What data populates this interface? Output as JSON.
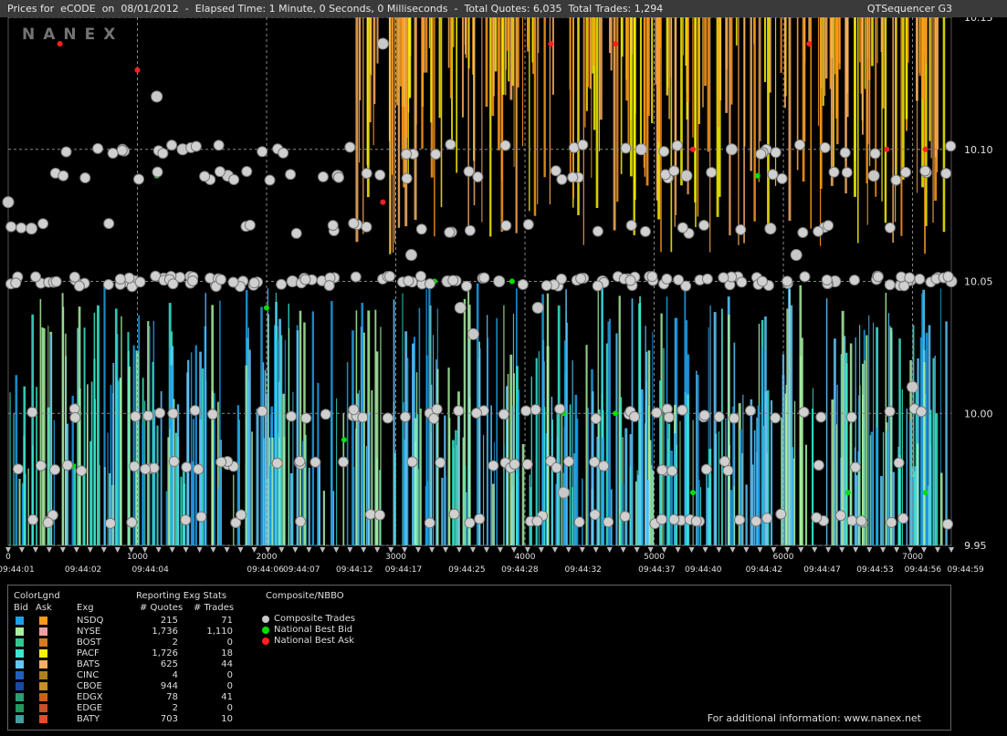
{
  "header": {
    "left_text": "Prices for  eCODE  on  08/01/2012  -  Elapsed Time: 1 Minute, 0 Seconds, 0 Milliseconds  -  Total Quotes: 6,035  Total Trades: 1,294",
    "right_text": "QTSequencer G3"
  },
  "watermark": "NANEX",
  "chart_data": {
    "type": "scatter",
    "title": "Prices for eCODE on 08/01/2012",
    "ylim": [
      9.95,
      10.15
    ],
    "y_ticks": [
      "10.15",
      "10.10",
      "10.05",
      "10.00",
      "9.95"
    ],
    "y_tick_values": [
      10.15,
      10.1,
      10.05,
      10.0,
      9.95
    ],
    "xlim": [
      0,
      7300
    ],
    "x_ticks": [
      "0",
      "1000",
      "2000",
      "3000",
      "4000",
      "5000",
      "6000",
      "7000"
    ],
    "x_tick_values": [
      0,
      1000,
      2000,
      3000,
      4000,
      5000,
      6000,
      7000
    ],
    "time_labels": [
      {
        "seq": 60,
        "label": "09:44:01"
      },
      {
        "seq": 580,
        "label": "09:44:02"
      },
      {
        "seq": 1100,
        "label": "09:44:04"
      },
      {
        "seq": 1990,
        "label": "09:44:06"
      },
      {
        "seq": 2270,
        "label": "09:44:07"
      },
      {
        "seq": 2680,
        "label": "09:44:12"
      },
      {
        "seq": 3060,
        "label": "09:44:17"
      },
      {
        "seq": 3550,
        "label": "09:44:25"
      },
      {
        "seq": 3960,
        "label": "09:44:28"
      },
      {
        "seq": 4450,
        "label": "09:44:32"
      },
      {
        "seq": 5020,
        "label": "09:44:37"
      },
      {
        "seq": 5380,
        "label": "09:44:40"
      },
      {
        "seq": 5850,
        "label": "09:44:42"
      },
      {
        "seq": 6300,
        "label": "09:44:47"
      },
      {
        "seq": 6710,
        "label": "09:44:53"
      },
      {
        "seq": 7080,
        "label": "09:44:56"
      },
      {
        "seq": 7410,
        "label": "09:44:59"
      }
    ],
    "grid": true,
    "series": [
      {
        "name": "Composite Trades",
        "color": "#c8c8c8",
        "points": [
          [
            0,
            10.08
          ],
          [
            180,
            10.07
          ],
          [
            900,
            10.05
          ],
          [
            1150,
            10.12
          ],
          [
            1350,
            10.1
          ],
          [
            1700,
            10.09
          ],
          [
            2200,
            10.05
          ],
          [
            2550,
            10.09
          ],
          [
            2900,
            10.14
          ],
          [
            3120,
            10.06
          ],
          [
            3400,
            10.05
          ],
          [
            3500,
            10.04
          ],
          [
            3600,
            10.03
          ],
          [
            3800,
            10.05
          ],
          [
            4100,
            10.04
          ],
          [
            4300,
            9.97
          ],
          [
            4600,
            10.05
          ],
          [
            4900,
            10.1
          ],
          [
            5250,
            10.09
          ],
          [
            5600,
            10.1
          ],
          [
            5900,
            10.07
          ],
          [
            6100,
            10.06
          ],
          [
            6400,
            10.05
          ],
          [
            6700,
            10.09
          ],
          [
            7000,
            10.01
          ],
          [
            7300,
            10.05
          ]
        ]
      },
      {
        "name": "National Best Bid",
        "color": "#00e000",
        "points": [
          [
            500,
            9.98
          ],
          [
            1150,
            10.09
          ],
          [
            2000,
            10.04
          ],
          [
            2600,
            9.99
          ],
          [
            3300,
            10.05
          ],
          [
            3900,
            10.05
          ],
          [
            4300,
            10.0
          ],
          [
            4700,
            10.0
          ],
          [
            5300,
            9.97
          ],
          [
            5800,
            10.09
          ],
          [
            6500,
            9.97
          ],
          [
            7100,
            9.97
          ]
        ]
      },
      {
        "name": "National Best Ask",
        "color": "#ff2020",
        "points": [
          [
            400,
            10.14
          ],
          [
            1000,
            10.13
          ],
          [
            2900,
            10.08
          ],
          [
            3200,
            10.07
          ],
          [
            4200,
            10.14
          ],
          [
            4700,
            10.14
          ],
          [
            5300,
            10.1
          ],
          [
            6200,
            10.14
          ],
          [
            6800,
            10.1
          ],
          [
            7100,
            10.1
          ]
        ]
      }
    ]
  },
  "legend": {
    "col_colorlgnd": "ColorLgnd",
    "col_bid": "Bid",
    "col_ask": "Ask",
    "col_exg": "Exg",
    "col_reporting": "Reporting Exg Stats",
    "col_quotes": "# Quotes",
    "col_trades": "# Trades",
    "col_composite": "Composite/NBBO",
    "rows": [
      {
        "exg": "NSDQ",
        "quotes": "215",
        "trades": "71",
        "bid_color": "#1ea0e8",
        "ask_color": "#ff9a1a"
      },
      {
        "exg": "NYSE",
        "quotes": "1,736",
        "trades": "1,110",
        "bid_color": "#a8f0a0",
        "ask_color": "#f0a0a0"
      },
      {
        "exg": "BOST",
        "quotes": "2",
        "trades": "0",
        "bid_color": "#30c890",
        "ask_color": "#d87820"
      },
      {
        "exg": "PACF",
        "quotes": "1,726",
        "trades": "18",
        "bid_color": "#38e8d0",
        "ask_color": "#f8f000"
      },
      {
        "exg": "BATS",
        "quotes": "625",
        "trades": "44",
        "bid_color": "#60c8ff",
        "ask_color": "#f8b060"
      },
      {
        "exg": "CINC",
        "quotes": "4",
        "trades": "0",
        "bid_color": "#2060c0",
        "ask_color": "#b08020"
      },
      {
        "exg": "CBOE",
        "quotes": "944",
        "trades": "0",
        "bid_color": "#1848a8",
        "ask_color": "#c89020"
      },
      {
        "exg": "EDGX",
        "quotes": "78",
        "trades": "41",
        "bid_color": "#28a078",
        "ask_color": "#d06010"
      },
      {
        "exg": "EDGE",
        "quotes": "2",
        "trades": "0",
        "bid_color": "#209860",
        "ask_color": "#c85028"
      },
      {
        "exg": "BATY",
        "quotes": "703",
        "trades": "10",
        "bid_color": "#40a0a0",
        "ask_color": "#e05020"
      }
    ],
    "nbbo": [
      {
        "label": "Composite Trades",
        "color": "#c8c8c8"
      },
      {
        "label": "National Best Bid",
        "color": "#00e000"
      },
      {
        "label": "National Best Ask",
        "color": "#ff2020"
      }
    ],
    "footer": "For additional information: www.nanex.net"
  }
}
